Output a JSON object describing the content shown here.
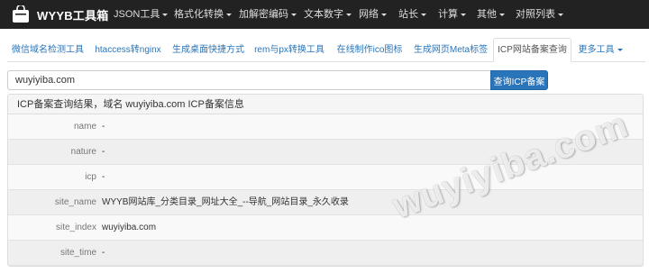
{
  "colors": {
    "navbar": "#222222",
    "accent": "#2a75b9",
    "panel": "#f5f5f5"
  },
  "navbar": {
    "brand": "WYYB工具箱",
    "brand_icon": "bag-icon",
    "items": [
      {
        "label": "JSON工具",
        "dropdown": true
      },
      {
        "label": "格式化转换",
        "dropdown": true
      },
      {
        "label": "加解密编码",
        "dropdown": true
      },
      {
        "label": "文本数字",
        "dropdown": true
      },
      {
        "label": "网络",
        "dropdown": true
      },
      {
        "label": "站长",
        "dropdown": true
      },
      {
        "label": "计算",
        "dropdown": true
      },
      {
        "label": "其他",
        "dropdown": true
      },
      {
        "label": "对照列表",
        "dropdown": true
      }
    ]
  },
  "tabs": {
    "active_index": 7,
    "items": [
      {
        "label": "微信域名检测工具"
      },
      {
        "label": "htaccess转nginx"
      },
      {
        "label": "生成桌面快捷方式"
      },
      {
        "label": "rem与px转换工具"
      },
      {
        "label": "在线制作ico图标"
      },
      {
        "label": "生成网页Meta标签"
      },
      {
        "label": "ICP网站备案查询"
      },
      {
        "label": "更多工具",
        "dropdown": true
      }
    ]
  },
  "search": {
    "value": "wuyiyiba.com",
    "placeholder": "",
    "button_label": "查询ICP备案"
  },
  "result": {
    "heading_prefix": "ICP备案查询结果，域名",
    "heading_domain": "wuyiyiba.com",
    "heading_suffix": "ICP备案信息",
    "rows": [
      {
        "label": "name",
        "value": "-"
      },
      {
        "label": "nature",
        "value": "-"
      },
      {
        "label": "icp",
        "value": "-"
      },
      {
        "label": "site_name",
        "value": "WYYB网站库_分类目录_网址大全_--导航_网站目录_永久收录"
      },
      {
        "label": "site_index",
        "value": "wuyiyiba.com"
      },
      {
        "label": "site_time",
        "value": "-"
      }
    ]
  },
  "watermark": "wuyiyiba.com"
}
